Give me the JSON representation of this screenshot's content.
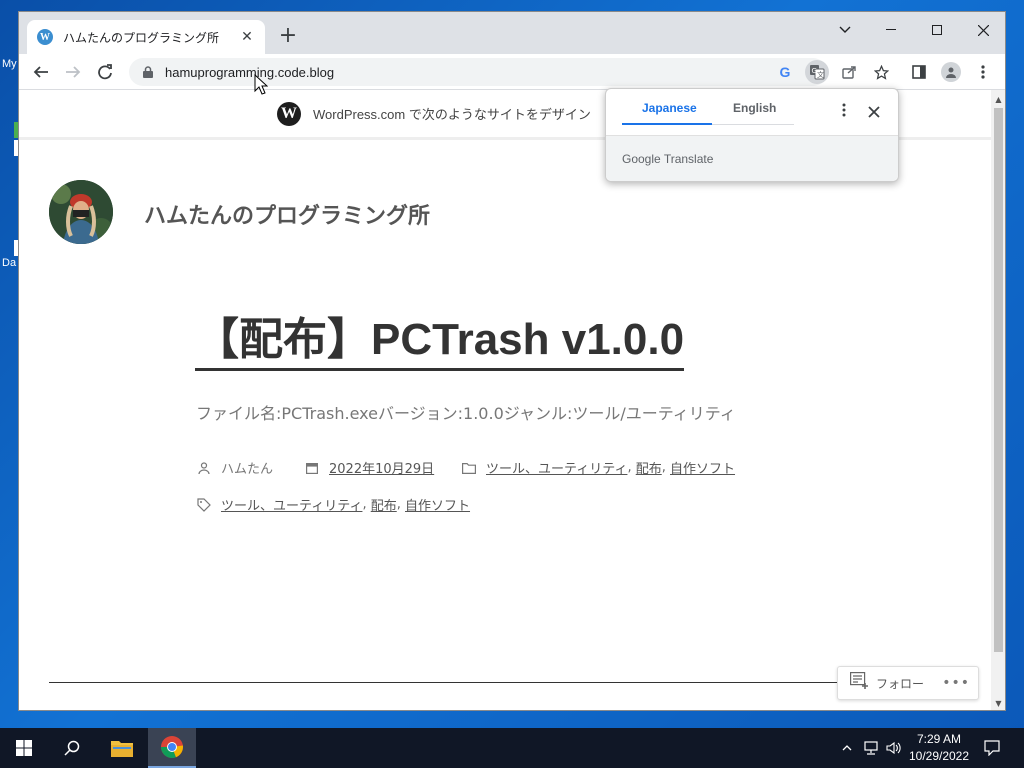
{
  "desktop": {
    "icon_label_1": "My",
    "icon_label_2": "Da"
  },
  "browser": {
    "tab": {
      "title": "ハムたんのプログラミング所",
      "favicon": "wordpress-icon"
    },
    "address_bar": {
      "url": "hamuprogramming.code.blog"
    }
  },
  "translate_popup": {
    "source_language": "Japanese",
    "target_language": "English",
    "footer": "Google Translate",
    "accent_color": "#1a73e8"
  },
  "page": {
    "wpcom_banner": "WordPress.com で次のようなサイトをデザイン",
    "site_title": "ハムたんのプログラミング所",
    "post": {
      "title": "【配布】PCTrash v1.0.0",
      "excerpt": "ファイル名:PCTrash.exeバージョン:1.0.0ジャンル:ツール/ユーティリティ",
      "author": "ハムたん",
      "date": "2022年10月29日",
      "categories": [
        "ツール、ユーティリティ",
        "配布",
        "自作ソフト"
      ],
      "tags": [
        "ツール、ユーティリティ",
        "配布",
        "自作ソフト"
      ]
    },
    "follow_button": "フォロー"
  },
  "taskbar": {
    "time": "7:29 AM",
    "date": "10/29/2022"
  }
}
